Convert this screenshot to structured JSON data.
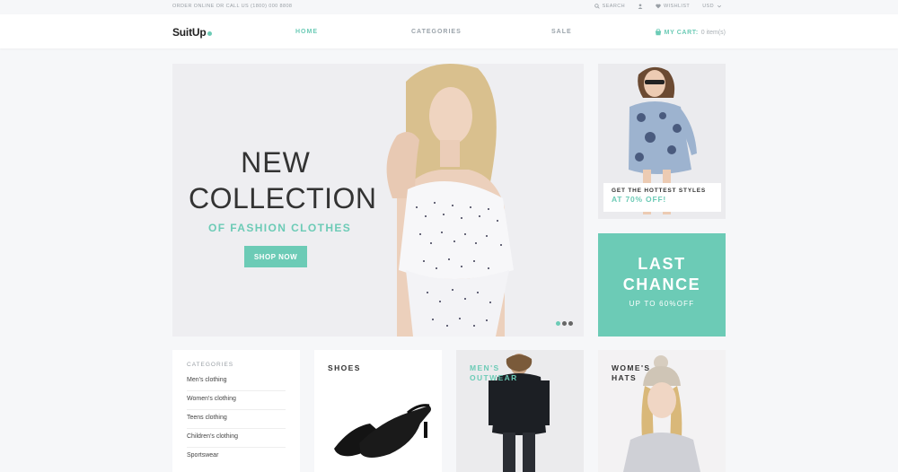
{
  "topbar": {
    "order_text": "ORDER ONLINE OR CALL US (1800) 000 8808",
    "search_label": "SEARCH",
    "wishlist_label": "WISHLIST",
    "currency": "USD"
  },
  "header": {
    "logo": "SuitUp",
    "nav": [
      {
        "label": "HOME"
      },
      {
        "label": "CATEGORIES"
      },
      {
        "label": "SALE"
      }
    ],
    "cart_label": "MY CART:",
    "cart_count": "0 item(s)"
  },
  "hero": {
    "title_line1": "NEW",
    "title_line2": "COLLECTION",
    "subtitle": "OF FASHION CLOTHES",
    "button": "SHOP NOW",
    "slides_total": 3,
    "active_slide": 1
  },
  "promo_styles": {
    "line1": "GET THE HOTTEST STYLES",
    "line2": "AT 70% OFF!"
  },
  "promo_last": {
    "line1": "LAST",
    "line2": "CHANCE",
    "line3": "UP TO 60%OFF"
  },
  "categories": {
    "title": "CATEGORIES",
    "items": [
      "Men's clothing",
      "Women's clothing",
      "Teens clothing",
      "Children's clothing",
      "Sportswear"
    ]
  },
  "tiles": {
    "shoes": "SHOES",
    "men": "MEN'S OUTWEAR",
    "women": "WOME'S HATS"
  },
  "colors": {
    "accent": "#6ccbb6",
    "text_dark": "#333333",
    "muted": "#9aa0a6"
  }
}
